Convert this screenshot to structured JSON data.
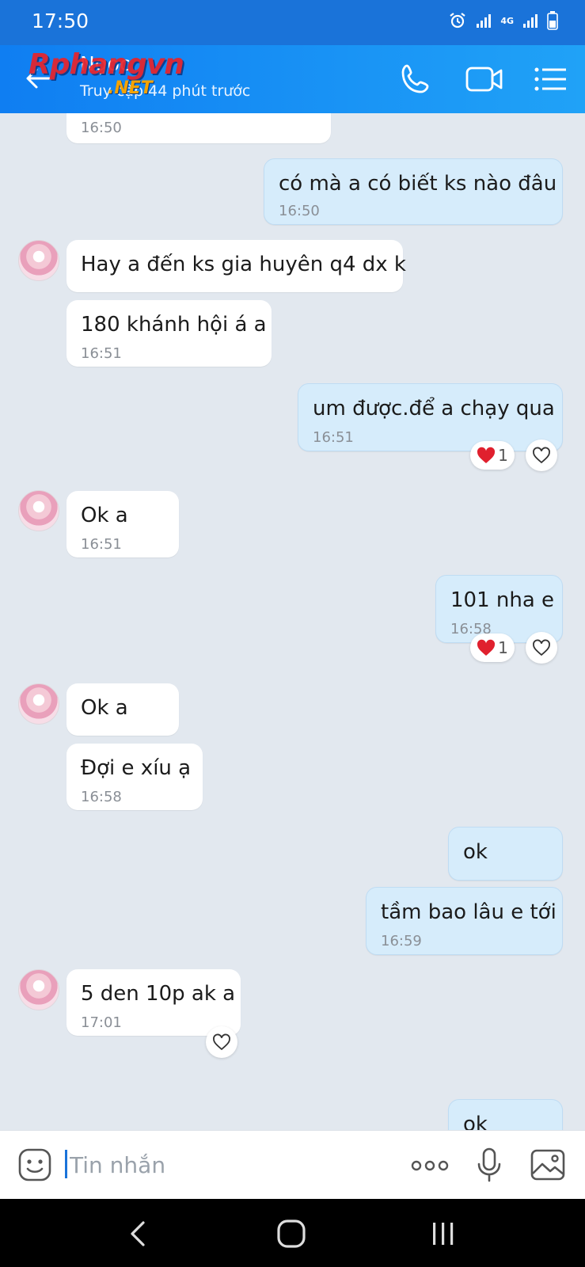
{
  "status_bar": {
    "time": "17:50",
    "network": "4G"
  },
  "header": {
    "contact_name": "Ngọc",
    "status": "Truy cập 44 phút trước",
    "watermark_text": "Rphangvn",
    "watermark_sub": ".NET"
  },
  "messages": [
    {
      "side": "in",
      "text": "",
      "time": "16:50"
    },
    {
      "side": "out",
      "text": "có mà a có biết ks nào đâu",
      "time": "16:50"
    },
    {
      "side": "in",
      "text": "Hay a đến ks gia huyên q4 dx k",
      "time": ""
    },
    {
      "side": "in",
      "text": "180 khánh hội á a",
      "time": "16:51"
    },
    {
      "side": "out",
      "text": "um được.để a chạy qua",
      "time": "16:51",
      "reaction_count": "1"
    },
    {
      "side": "in",
      "text": "Ok a",
      "time": "16:51"
    },
    {
      "side": "out",
      "text": "101 nha e",
      "time": "16:58",
      "reaction_count": "1"
    },
    {
      "side": "in",
      "text": "Ok a",
      "time": ""
    },
    {
      "side": "in",
      "text": "Đợi e xíu ạ",
      "time": "16:58"
    },
    {
      "side": "out",
      "text": "ok",
      "time": ""
    },
    {
      "side": "out",
      "text": "tầm bao lâu e tới",
      "time": "16:59"
    },
    {
      "side": "in",
      "text": "5 den 10p ak a",
      "time": "17:01"
    },
    {
      "side": "out",
      "text": "ok",
      "time": ""
    }
  ],
  "input": {
    "placeholder": "Tin nhắn"
  },
  "colors": {
    "header_blue": "#1a73d9",
    "chat_bg": "#e2e8ef",
    "my_bubble": "#d6ecfb",
    "their_bubble": "#ffffff",
    "heart_red": "#e0202e"
  }
}
